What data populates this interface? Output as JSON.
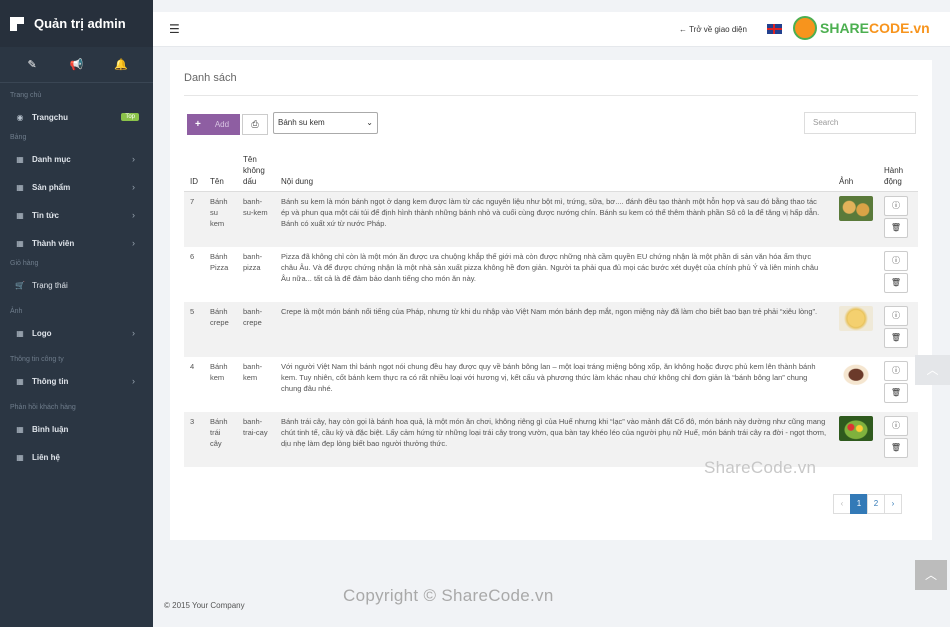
{
  "sidebar": {
    "brand_title": "Quản trị admin",
    "quick_icons": [
      "magic-wand-icon",
      "bullhorn-icon",
      "bell-icon"
    ],
    "sections": {
      "s1": "Trang chủ",
      "s2": "Bảng",
      "s3": "Giỏ hàng",
      "s4": "Ảnh",
      "s5": "Thông tin công ty",
      "s6": "Phản hồi khách hàng"
    },
    "items": {
      "home": "Trangchu",
      "home_badge": "Top",
      "category": "Danh mục",
      "product": "Sản phẩm",
      "news": "Tin tức",
      "member": "Thành viên",
      "status": "Trạng thái",
      "logo": "Logo",
      "info": "Thông tin",
      "comments": "Bình luận",
      "contact": "Liên hệ"
    }
  },
  "topbar": {
    "back_label": "← Trở về giao diện",
    "brand_left": "SHARE",
    "brand_right": "CODE.vn"
  },
  "panel": {
    "title": "Danh sách",
    "add_label": "Add",
    "category_select": "Bánh su kem",
    "search_placeholder": "Search"
  },
  "table": {
    "headers": {
      "id": "ID",
      "name": "Tên",
      "slug": "Tên không dấu",
      "content": "Nội dung",
      "image": "Ảnh",
      "actions": "Hành động"
    },
    "rows": [
      {
        "id": "7",
        "name": "Bánh su kem",
        "slug": "banh-su-kem",
        "content": "Bánh su kem là món bánh ngọt ở dạng kem được làm từ các nguyên liệu như bột mì, trứng, sữa, bơ.... đánh đều tạo thành một hỗn hợp và sau đó bằng thao tác ép và phun qua một cái túi để định hình thành những bánh nhỏ và cuối cùng được nướng chín. Bánh su kem có thể thêm thành phần Sô cô la để tăng vị hấp dẫn. Bánh có xuất xứ từ nước Pháp.",
        "image": "cream-puff-image"
      },
      {
        "id": "6",
        "name": "Bánh Pizza",
        "slug": "banh-pizza",
        "content": "Pizza đã không chỉ còn là một món ăn được ưa chuộng khắp thế giới mà còn được những nhà cầm quyền EU chứng nhận là một phần di sản văn hóa ẩm thực châu Âu. Và để được chứng nhận là một nhà sản xuất pizza không hề đơn giản. Người ta phải qua đủ mọi các bước xét duyệt của chính phủ Ý và liên minh châu Âu nữa... tất cả là để đảm bảo danh tiếng cho món ăn này.",
        "image": ""
      },
      {
        "id": "5",
        "name": "Bánh crepe",
        "slug": "banh-crepe",
        "content": "Crepe là một món bánh nổi tiếng của Pháp, nhưng từ khi du nhập vào Việt Nam món bánh đẹp mắt, ngon miệng này đã làm cho biết bao bạn trẻ phải “xiêu lòng”.",
        "image": "crepe-image"
      },
      {
        "id": "4",
        "name": "Bánh kem",
        "slug": "banh-kem",
        "content": "Với người Việt Nam thì bánh ngọt nói chung đều hay được quy về bánh bông lan – một loại tráng miệng bông xốp, ăn không hoặc được phủ kem lên thành bánh kem. Tuy nhiên, cốt bánh kem thực ra có rất nhiều loại với hương vị, kết cấu và phương thức làm khác nhau chứ không chỉ đơn giản là “bánh bông lan” chung chung đâu nhé.",
        "image": "cake-image"
      },
      {
        "id": "3",
        "name": "Bánh trái cây",
        "slug": "banh-trai-cay",
        "content": "Bánh trái cây, hay còn gọi là bánh hoa quả, là một món ăn chơi, không riêng gì của Huế nhưng khi “lạc” vào mảnh đất Cố đô, món bánh này dường như cũng mang chút tinh tế, cầu kỳ và đặc biệt. Lấy cảm hứng từ những loại trái cây trong vườn, qua bàn tay khéo léo của người phụ nữ Huế, món bánh trái cây ra đời - ngọt thơm, dịu nhẹ làm đẹp lòng biết bao người thưởng thức.",
        "image": "fruit-cake-image"
      }
    ]
  },
  "pagination": {
    "prev": "‹",
    "page1": "1",
    "page2": "2",
    "next": "›"
  },
  "watermarks": {
    "mid": "ShareCode.vn",
    "bottom": "Copyright © ShareCode.vn"
  },
  "footer": "© 2015 Your Company",
  "colors": {
    "sidebar": "#2b3643",
    "add_button": "#8e5ea2",
    "pager_active": "#337ab7"
  }
}
